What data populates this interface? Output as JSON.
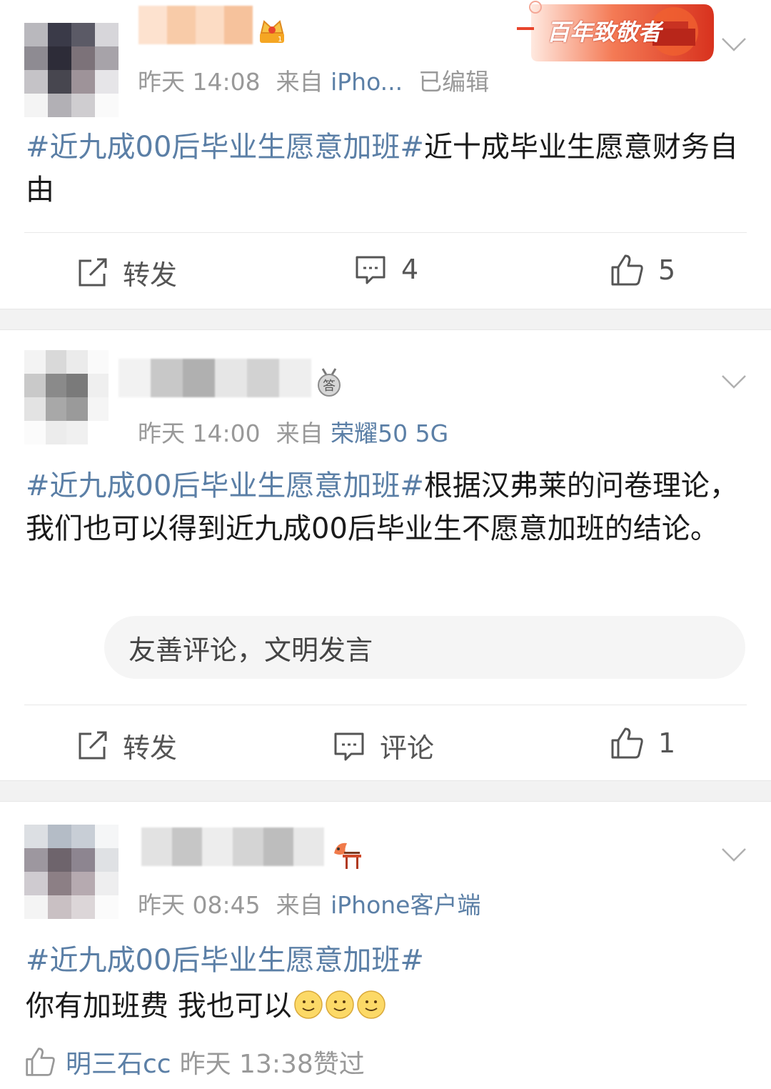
{
  "posts": [
    {
      "time": "昨天 14:08",
      "source_prefix": "来自",
      "source": "iPho...",
      "edited": "已编辑",
      "topic": "#近九成00后毕业生愿意加班#",
      "text": "近十成毕业生愿意财务自由",
      "actions": {
        "repost": "转发",
        "comment": "4",
        "like": "5"
      }
    },
    {
      "time": "昨天 14:00",
      "source_prefix": "来自",
      "source": "荣耀50 5G",
      "badge": "答",
      "topic": "#近九成00后毕业生愿意加班#",
      "text": "根据汉弗莱的问卷理论，我们也可以得到近九成00后毕业生不愿意加班的结论。",
      "comment_placeholder": "友善评论，文明发言",
      "actions": {
        "repost": "转发",
        "comment": "评论",
        "like": "1"
      }
    },
    {
      "time": "昨天 08:45",
      "source_prefix": "来自",
      "source": "iPhone客户端",
      "topic": "#近九成00后毕业生愿意加班#",
      "text": "你有加班费 我也可以",
      "liked": {
        "user": "明三石cc",
        "time": "昨天 13:38",
        "suffix": "赞过"
      }
    }
  ],
  "banner": {
    "text": "百年致敬者"
  },
  "icons": [
    "crown-icon",
    "chevron-down-icon",
    "repost-icon",
    "comment-icon",
    "thumbs-up-icon",
    "answer-medal-icon",
    "koi-gate-icon",
    "smiley-emoji"
  ],
  "colors": {
    "link": "#5b7fa6",
    "meta": "#999999",
    "separator": "#f2f2f2",
    "banner": "#e8452c"
  }
}
